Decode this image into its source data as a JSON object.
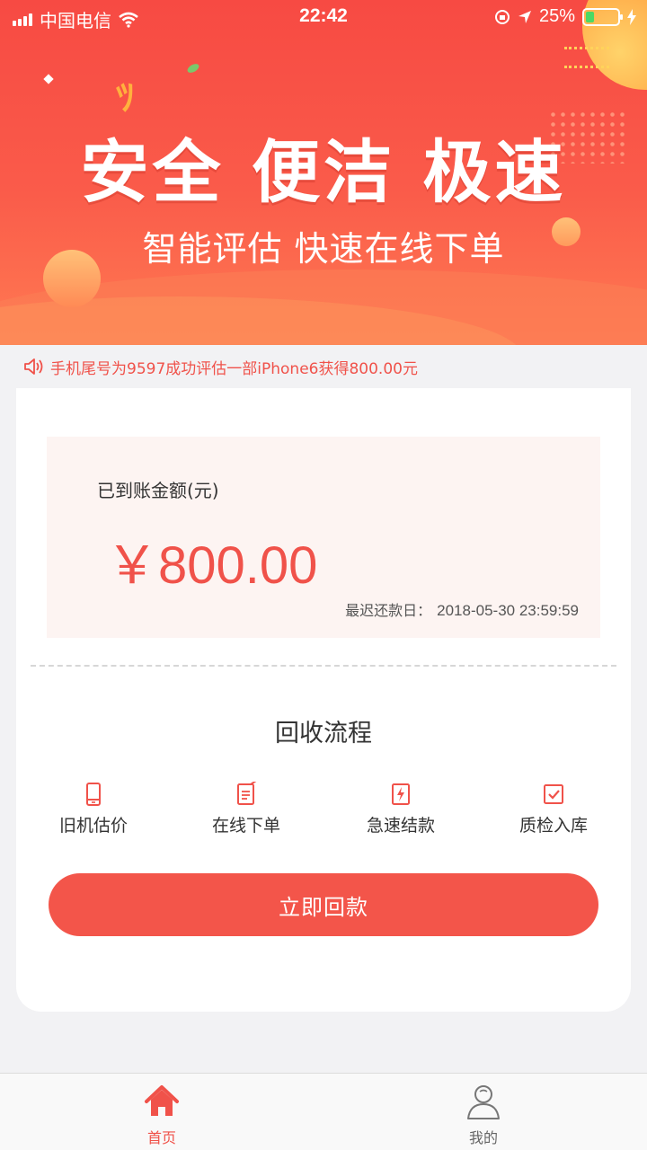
{
  "status_bar": {
    "carrier": "中国电信",
    "time": "22:42",
    "battery_percent": "25%"
  },
  "banner": {
    "headline": "安全 便洁 极速",
    "subline": "智能评估 快速在线下单"
  },
  "notice": {
    "text": "手机尾号为9597成功评估一部iPhone6获得800.00元"
  },
  "account": {
    "amount_label": "已到账金额(元)",
    "amount_value": "￥800.00",
    "due_label": "最迟还款日：",
    "due_date": "2018-05-30 23:59:59"
  },
  "process": {
    "title": "回收流程",
    "steps": [
      {
        "label": "旧机估价",
        "icon": "phone-icon"
      },
      {
        "label": "在线下单",
        "icon": "order-icon"
      },
      {
        "label": "急速结款",
        "icon": "lightning-icon"
      },
      {
        "label": "质检入库",
        "icon": "check-icon"
      }
    ]
  },
  "cta": {
    "label": "立即回款"
  },
  "tabbar": {
    "items": [
      {
        "label": "首页",
        "icon": "home-icon",
        "active": true
      },
      {
        "label": "我的",
        "icon": "user-icon",
        "active": false
      }
    ]
  },
  "colors": {
    "brand": "#f0524a",
    "amount_bg": "#fdf4f2"
  }
}
